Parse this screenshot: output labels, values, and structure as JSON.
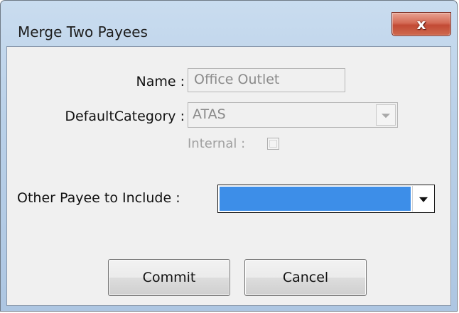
{
  "window": {
    "title": "Merge Two Payees",
    "close_label": "x"
  },
  "form": {
    "name_label": "Name :",
    "name_value": "Office Outlet",
    "default_category_label": "DefaultCategory :",
    "default_category_value": "ATAS",
    "internal_label": "Internal :",
    "internal_checked": false,
    "other_payee_label": "Other Payee to Include :",
    "other_payee_value": ""
  },
  "buttons": {
    "commit_label": "Commit",
    "cancel_label": "Cancel"
  },
  "colors": {
    "selection_highlight": "#3d8ee8",
    "close_button": "#c24a34",
    "frame": "#b9d0e8"
  }
}
